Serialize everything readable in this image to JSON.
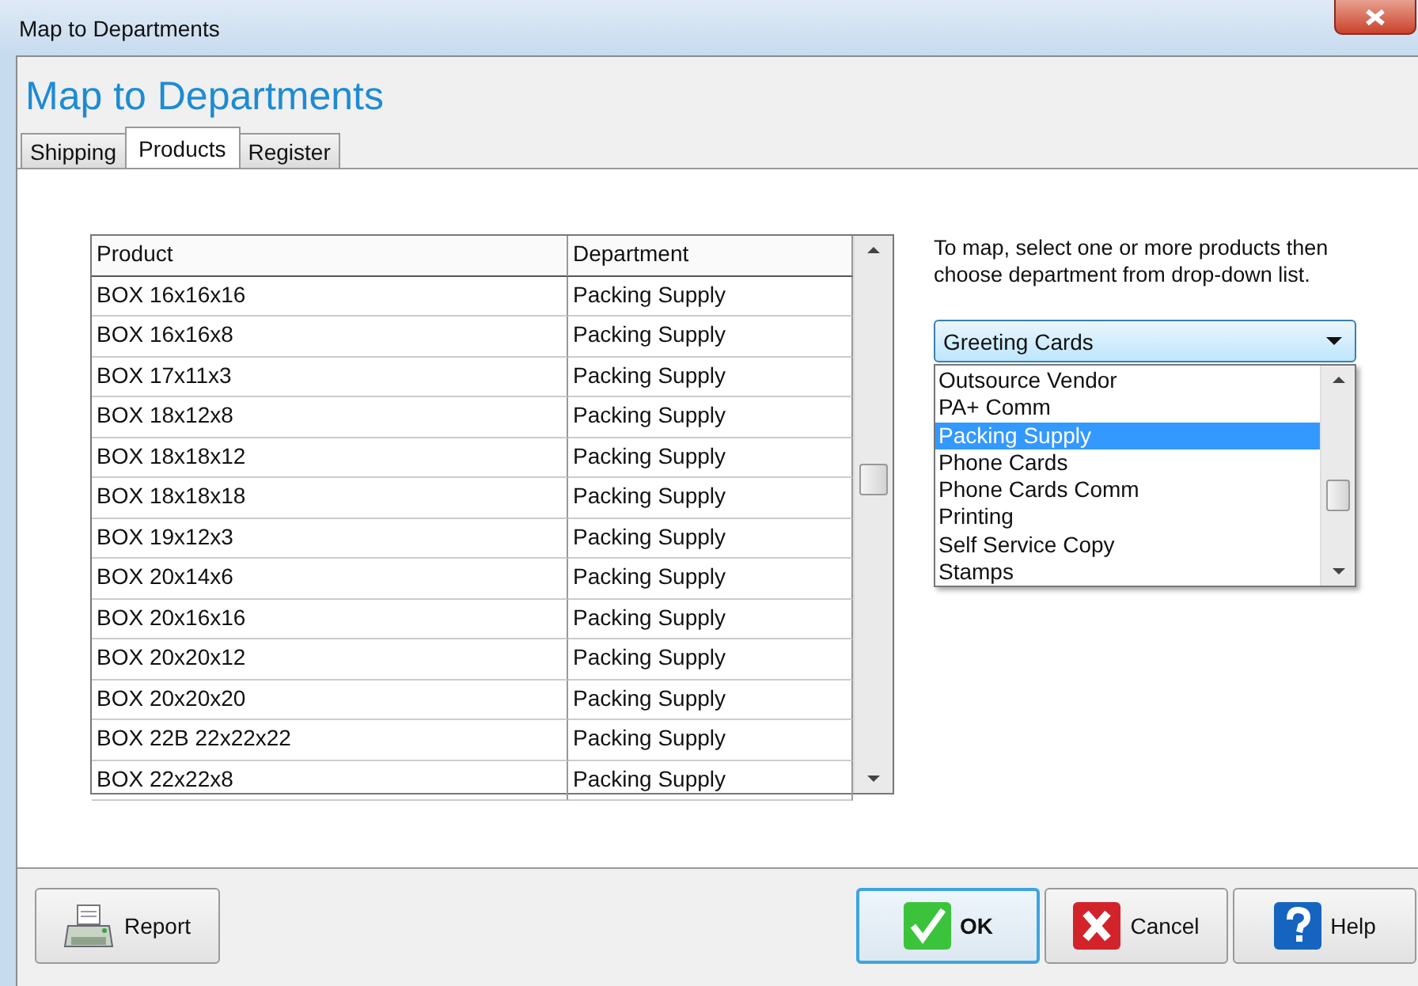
{
  "window": {
    "title": "Map to Departments"
  },
  "heading": "Map to Departments",
  "tabs": [
    {
      "label": "Shipping",
      "selected": false
    },
    {
      "label": "Products",
      "selected": true
    },
    {
      "label": "Register",
      "selected": false
    }
  ],
  "table": {
    "columns": [
      "Product",
      "Department"
    ],
    "rows": [
      {
        "product": "BOX 16x16x16",
        "department": "Packing Supply"
      },
      {
        "product": "BOX 16x16x8",
        "department": "Packing Supply"
      },
      {
        "product": "BOX 17x11x3",
        "department": "Packing Supply"
      },
      {
        "product": "BOX 18x12x8",
        "department": "Packing Supply"
      },
      {
        "product": "BOX 18x18x12",
        "department": "Packing Supply"
      },
      {
        "product": "BOX 18x18x18",
        "department": "Packing Supply"
      },
      {
        "product": "BOX 19x12x3",
        "department": "Packing Supply"
      },
      {
        "product": "BOX 20x14x6",
        "department": "Packing Supply"
      },
      {
        "product": "BOX 20x16x16",
        "department": "Packing Supply"
      },
      {
        "product": "BOX 20x20x12",
        "department": "Packing Supply"
      },
      {
        "product": "BOX 20x20x20",
        "department": "Packing Supply"
      },
      {
        "product": "BOX 22B 22x22x22",
        "department": "Packing Supply"
      },
      {
        "product": "BOX 22x22x8",
        "department": "Packing Supply"
      }
    ]
  },
  "instructions": "To map, select one or more products then choose department from drop-down list.",
  "dropdown": {
    "value": "Greeting Cards",
    "expanded": true,
    "options": [
      {
        "label": "Outsource Vendor",
        "selected": false
      },
      {
        "label": "PA+ Comm",
        "selected": false
      },
      {
        "label": "Packing Supply",
        "selected": true
      },
      {
        "label": "Phone Cards",
        "selected": false
      },
      {
        "label": "Phone Cards Comm",
        "selected": false
      },
      {
        "label": "Printing",
        "selected": false
      },
      {
        "label": "Self Service Copy",
        "selected": false
      },
      {
        "label": "Stamps",
        "selected": false
      }
    ]
  },
  "buttons": [
    {
      "label": "Report",
      "kind": "report",
      "default": false
    },
    {
      "label": "OK",
      "kind": "ok",
      "default": true
    },
    {
      "label": "Cancel",
      "kind": "cancel",
      "default": false
    },
    {
      "label": "Help",
      "kind": "help",
      "default": false
    }
  ]
}
